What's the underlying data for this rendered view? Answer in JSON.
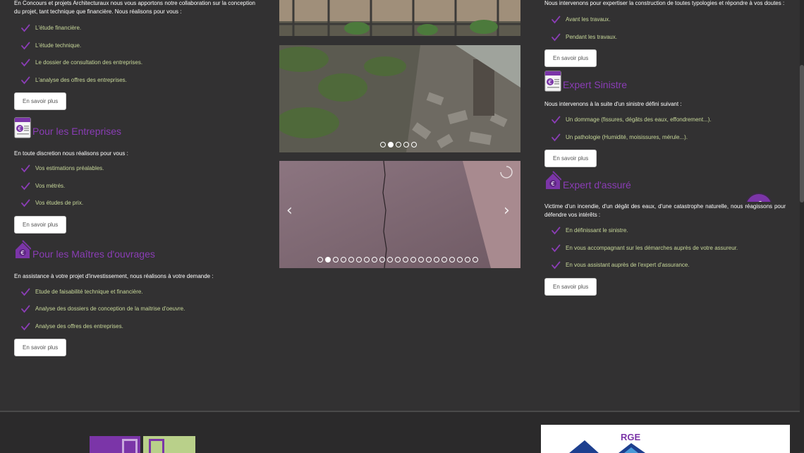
{
  "left": {
    "intro": "En Concours et projets Architecturaux nous vous apportons notre collaboration sur la conception du projet, tant technique que financière. Nous réalisons pour vous :",
    "intro_items": [
      "L'étude financière.",
      "L'étude technique.",
      "Le dossier de consultation des entreprises.",
      "L'analyse des offres des entreprises."
    ],
    "button": "En savoir plus",
    "entreprises": {
      "title": "Pour les Entreprises",
      "text": "En toute discretion nous réalisons pour vous :",
      "items": [
        "Vos estimations préalables.",
        "Vos métrés.",
        "Vos études de prix."
      ],
      "button": "En savoir plus"
    },
    "maitres": {
      "title": "Pour les Maîtres d'ouvrages",
      "text": "En assistance à votre projet d'investissement, nous réalisons à votre demande :",
      "items": [
        "Etude de faisabilité technique et financière.",
        "Analyse des dossiers de conception de la maitrise d'oeuvre.",
        "Analyse des offres des entreprises."
      ],
      "button": "En savoir plus"
    }
  },
  "right": {
    "intro": "Nous intervenons pour expertiser la construction de toutes typologies et répondre à vos doutes :",
    "intro_items": [
      "Avant les travaux.",
      "Pendant les travaux."
    ],
    "button": "En savoir plus",
    "sinistre": {
      "title": "Expert Sinistre",
      "text": "Nous intervenons à la suite d'un sinistre défini suivant :",
      "items": [
        "Un dommage (fissures, dégâts des eaux, effondrement...).",
        "Un pathologie (Humidité, moisissures, mérule...)."
      ],
      "button": "En savoir plus"
    },
    "assure": {
      "title": "Expert d'assuré",
      "text": "Victime d'un incendie, d'un dégât des eaux, d'une catastrophe naturelle, nous réagissons pour défendre vos intérêts :",
      "items": [
        "En définissant le sinistre.",
        "En vous accompagnant sur les démarches auprès de votre assureur.",
        "En vous assistant auprès de l'expert d'assurance."
      ],
      "button": "En savoir plus"
    }
  },
  "slider": {
    "middle_dots": 5,
    "middle_active": 2,
    "bottom_dots": 21,
    "bottom_active": 2,
    "prev_arrow": "‹",
    "next_arrow": "›"
  },
  "footer": {
    "badge": "RGE"
  },
  "colors": {
    "bg": "#323132",
    "accent": "#8a3db5",
    "list_text": "#c8d89a"
  }
}
